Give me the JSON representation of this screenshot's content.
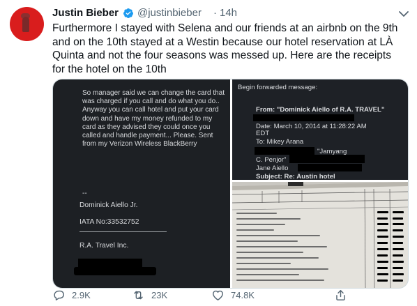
{
  "tweet": {
    "author_name": "Justin Bieber",
    "handle": "@justinbieber",
    "separator": "·",
    "timestamp": "14h",
    "text": "Furthermore I stayed with Selena and our friends at an airbnb on the 9th and on the 10th stayed at a Westin because our hotel reservation at LÀ Quinta and not the four seasons was messed up. Here are the receipts for the hotel on the 10th",
    "accent_color": "#1d9bf0"
  },
  "media": {
    "left_image": {
      "message": "So manager said we can change the card that was charged if you call and do what you do.. Anyway you can call hotel and put your card down and have my money refunded to my card as they advised they could once you called and handle payment... Please. Sent from my Verizon Wireless BlackBerry",
      "dashes": "--",
      "signature_name": "Dominick Aiello Jr.",
      "signature_iata": "IATA No:33532752",
      "signature_agency": "R.A. Travel Inc."
    },
    "right_top_image": {
      "forwarded_label": "Begin forwarded message:",
      "from_line": "From: \"Dominick Aiello of R.A. TRAVEL\"",
      "date_line": "Date: March 10, 2014 at 11:28:22 AM",
      "date_tz": "EDT",
      "to_line": "To: Mikey Arana",
      "jamyang": "\"Jamyang",
      "c_penjor": "C. Penjor\"",
      "jane": "Jane Aiello",
      "subject_line": "Subject: Re:  Austin hotel"
    },
    "right_bottom_image": {
      "header_cells": [
        "ORDERED BY",
        "P.O. No.",
        "AGENT",
        "PROJECT/JOB"
      ],
      "sub_header": "Description",
      "right_header_cells": [
        "Qty",
        "Rate",
        "Amount"
      ]
    }
  },
  "actions": {
    "reply_count": "2.9K",
    "retweet_count": "23K",
    "like_count": "74.8K"
  }
}
